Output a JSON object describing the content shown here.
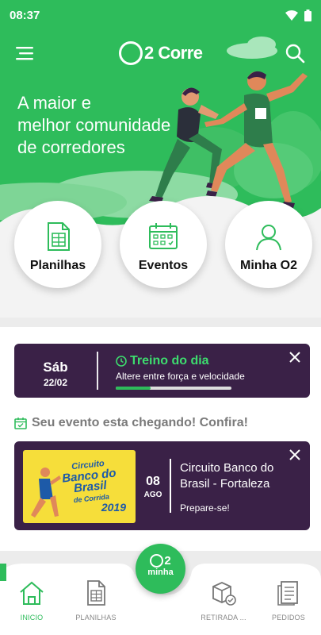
{
  "status": {
    "time": "08:37"
  },
  "header": {
    "logo_text": "2 Corre",
    "hero_title_lines": [
      "A maior e",
      "melhor comunidade",
      "de corredores"
    ]
  },
  "quick_actions": [
    {
      "label": "Planilhas",
      "icon": "spreadsheet-icon"
    },
    {
      "label": "Eventos",
      "icon": "calendar-icon"
    },
    {
      "label": "Minha O2",
      "icon": "user-icon"
    }
  ],
  "treino_card": {
    "day_name": "Sáb",
    "day_date": "22/02",
    "title": "Treino do dia",
    "subtitle": "Altere entre força e velocidade",
    "progress": 0.3
  },
  "notice": {
    "text": "Seu evento esta chegando! Confira!"
  },
  "event_card": {
    "poster_title_lines": [
      "Circuito",
      "Banco do",
      "Brasil",
      "de Corrida"
    ],
    "poster_year": "2019",
    "day": "08",
    "month": "AGO",
    "title": "Circuito Banco do Brasil - Fortaleza",
    "subtitle": "Prepare-se!"
  },
  "tabbar": {
    "items": [
      {
        "label": "INICIO",
        "icon": "home-icon",
        "active": true
      },
      {
        "label": "PLANILHAS",
        "icon": "spreadsheet-icon",
        "active": false
      },
      {
        "label": "RETIRADA ...",
        "icon": "package-check-icon",
        "active": false
      },
      {
        "label": "PEDIDOS",
        "icon": "orders-icon",
        "active": false
      }
    ],
    "fab_number": "2",
    "fab_label": "minha"
  },
  "colors": {
    "brand_green": "#2ebc5b",
    "card_purple": "#3a2147",
    "accent_green_text": "#3ddc6e"
  }
}
